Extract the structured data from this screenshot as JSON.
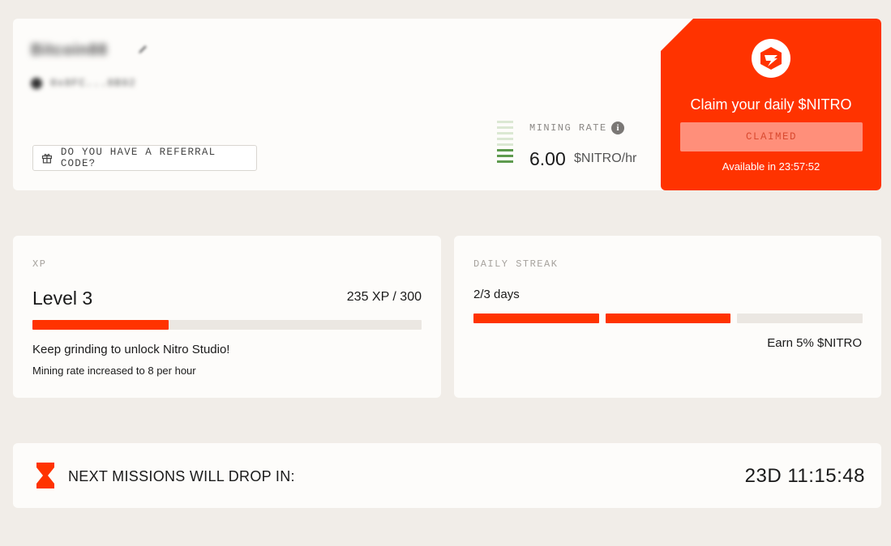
{
  "profile": {
    "username": "Bitcoin88",
    "wallet": "0x8FC...8B92",
    "referral_label": "DO YOU HAVE A REFERRAL CODE?"
  },
  "mining": {
    "label": "MINING RATE",
    "info": "i",
    "value": "6.00",
    "unit": "$NITRO/hr",
    "bars_active": 3,
    "bars_total": 8,
    "bar_active_color": "#5e9a4e",
    "bar_inactive_color": "#dbe8d3"
  },
  "claim": {
    "title": "Claim your daily $NITRO",
    "button_label": "CLAIMED",
    "available_text": "Available in 23:57:52",
    "accent_color": "#ff3300"
  },
  "xp": {
    "label": "XP",
    "level": "Level 3",
    "count": "235 XP / 300",
    "progress": 0.35,
    "message": "Keep grinding to unlock Nitro Studio!",
    "sub_message": "Mining rate increased to 8 per hour"
  },
  "streak": {
    "label": "DAILY STREAK",
    "days_text": "2/3 days",
    "segments_filled": 2,
    "segments_total": 3,
    "reward": "Earn 5% $NITRO"
  },
  "missions": {
    "label": "NEXT MISSIONS WILL DROP IN:",
    "timer": "23D 11:15:48"
  }
}
